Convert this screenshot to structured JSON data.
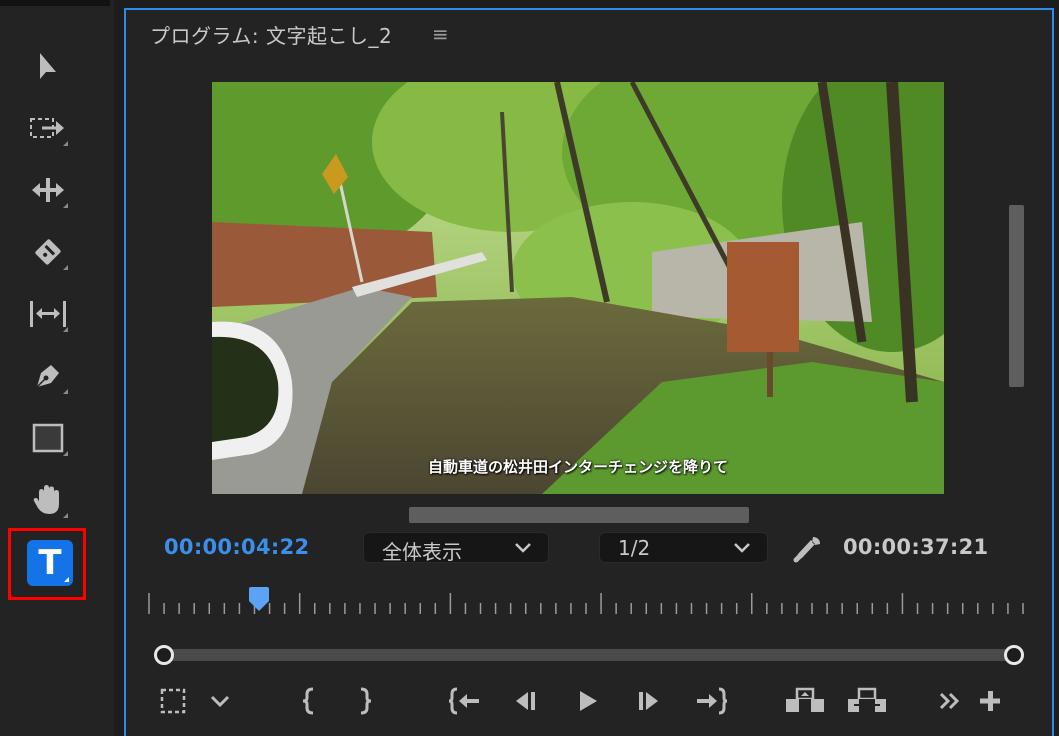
{
  "tools": [
    {
      "id": "selection",
      "icon": "selection-arrow-icon",
      "has_submenu": false
    },
    {
      "id": "track-select",
      "icon": "track-select-forward-icon",
      "has_submenu": true
    },
    {
      "id": "ripple-edit",
      "icon": "ripple-edit-icon",
      "has_submenu": true
    },
    {
      "id": "razor",
      "icon": "razor-icon",
      "has_submenu": true
    },
    {
      "id": "slip",
      "icon": "slip-icon",
      "has_submenu": true
    },
    {
      "id": "pen",
      "icon": "pen-icon",
      "has_submenu": true
    },
    {
      "id": "rectangle",
      "icon": "rectangle-icon",
      "has_submenu": true
    },
    {
      "id": "hand",
      "icon": "hand-icon",
      "has_submenu": true
    },
    {
      "id": "type",
      "icon": "type-tool-icon",
      "label": "T",
      "selected": true,
      "highlighted": true
    }
  ],
  "monitor": {
    "title": "プログラム: 文字起こし_2",
    "menu_icon": "≡",
    "subtitle": "自動車道の松井田インターチェンジを降りて",
    "current_time": "00:00:04:22",
    "duration": "00:00:37:21",
    "zoom_select": "全体表示",
    "resolution_select": "1/2",
    "playhead_fraction": 0.13
  },
  "transport": [
    "add-marker-icon",
    "chevron-down-icon",
    "mark-in-icon",
    "mark-out-icon",
    "go-to-in-icon",
    "step-back-icon",
    "play-icon",
    "step-forward-icon",
    "go-to-out-icon",
    "lift-icon",
    "extract-icon",
    "more-icon",
    "add-button-icon"
  ],
  "colors": {
    "accent_blue": "#3b8fe8",
    "panel_border": "#2d8ceb",
    "highlight_red": "#ff0000",
    "type_tool_bg": "#1473e6"
  }
}
